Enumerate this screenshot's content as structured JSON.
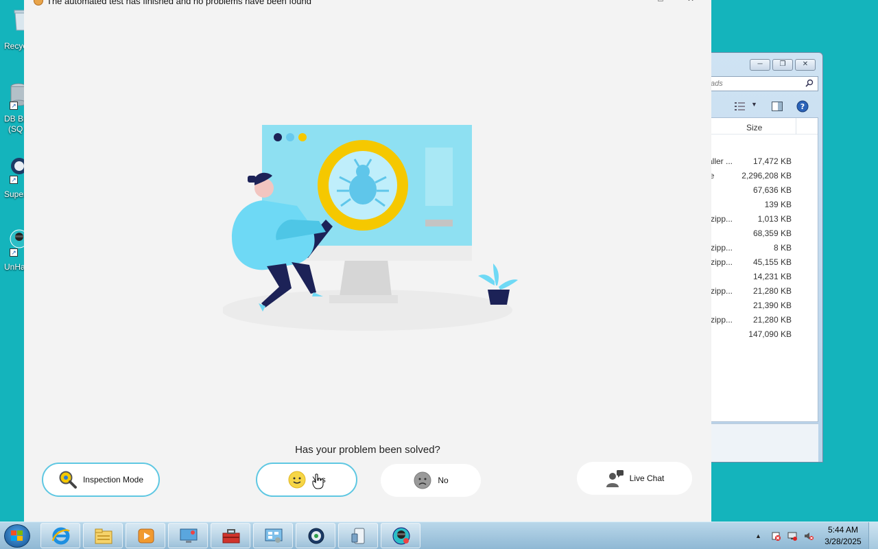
{
  "desktop": {
    "icons": [
      {
        "label": "Recyc",
        "icon": "recycle-bin-icon"
      },
      {
        "label": "DB Br",
        "label2": "(SQ",
        "icon": "database-icon"
      },
      {
        "label": "Super",
        "icon": "globe-shortcut-icon"
      },
      {
        "label": "UnHa",
        "icon": "hacker-shortcut-icon"
      }
    ]
  },
  "explorer": {
    "search_placeholder": "ads",
    "column_size": "Size",
    "rows": [
      {
        "name": "aller ...",
        "size": "17,472 KB"
      },
      {
        "name": "le",
        "size": "2,296,208 KB"
      },
      {
        "name": "",
        "size": "67,636 KB"
      },
      {
        "name": "",
        "size": "139 KB"
      },
      {
        "name": "(zipp...",
        "size": "1,013 KB"
      },
      {
        "name": "",
        "size": "68,359 KB"
      },
      {
        "name": "(zipp...",
        "size": "8 KB"
      },
      {
        "name": "(zipp...",
        "size": "45,155 KB"
      },
      {
        "name": "",
        "size": "14,231 KB"
      },
      {
        "name": "(zipp...",
        "size": "21,280 KB"
      },
      {
        "name": "",
        "size": "21,390 KB"
      },
      {
        "name": "(zipp...",
        "size": "21,280 KB"
      },
      {
        "name": "",
        "size": "147,090 KB"
      }
    ]
  },
  "app": {
    "title": "The automated test has finished and no problems have been found",
    "question": "Has your problem been solved?",
    "buttons": {
      "inspection": "Inspection Mode",
      "yes": "Yes",
      "no": "No",
      "live_chat": "Live Chat"
    },
    "colors": {
      "accent": "#5ec7e2",
      "monitor": "#8ee0f2",
      "magnifier": "#f5c800",
      "navy": "#1c2257"
    }
  },
  "taskbar": {
    "items": [
      "internet-explorer-icon",
      "file-explorer-icon",
      "media-player-icon",
      "remote-desktop-icon",
      "toolbox-icon",
      "control-panel-icon",
      "browser-globe-icon",
      "device-icon",
      "hacker-app-icon"
    ],
    "time": "5:44 AM",
    "date": "3/28/2025"
  }
}
